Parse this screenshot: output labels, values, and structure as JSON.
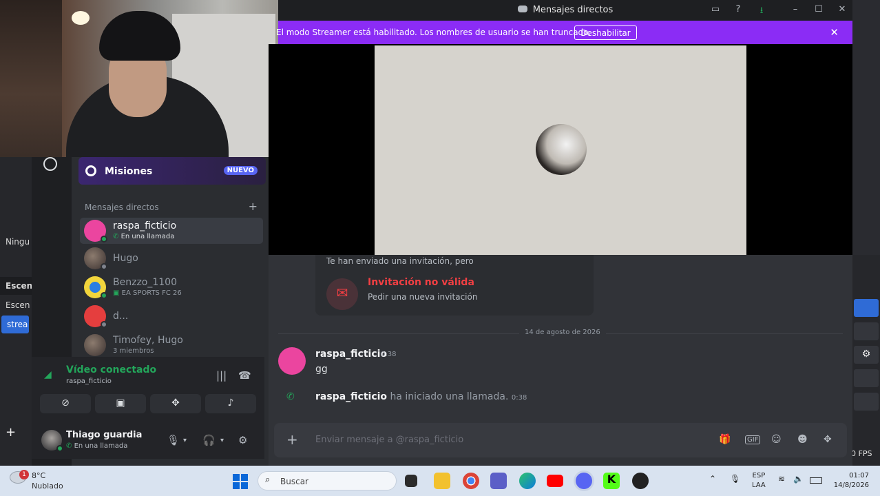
{
  "window": {
    "title": "Mensajes directos"
  },
  "banner": {
    "text": "El modo Streamer está habilitado. Los nombres de usuario se han truncado.",
    "button": "Deshabilitar",
    "color": "#8b2cf5"
  },
  "background_app": {
    "rows": [
      "Ningu",
      "Escen",
      "Escen",
      "strea"
    ],
    "fps": "0 FPS"
  },
  "sidebar": {
    "quests_label": "Misiones",
    "quests_badge": "NUEVO",
    "dm_header": "Mensajes directos",
    "dms": [
      {
        "name": "raspa_ficticio",
        "status": "En una llamada"
      },
      {
        "name": "Hugo",
        "status": ""
      },
      {
        "name": "Benzzo_1100",
        "status": "EA SPORTS FC 26"
      },
      {
        "name": "d...",
        "status": ""
      },
      {
        "name": "Timofey, Hugo",
        "status": "3 miembros"
      }
    ]
  },
  "voice_panel": {
    "title": "Vídeo conectado",
    "channel": "raspa_ficticio"
  },
  "user_panel": {
    "name": "Thiago guardia",
    "status": "En una llamada"
  },
  "chat": {
    "invite_header": "Te han enviado una invitación, pero",
    "invite_title": "Invitación no válida",
    "invite_subtitle": "Pedir una nueva invitación",
    "date_divider": "14 de agosto de 2026",
    "message_author": "raspa_ficticio",
    "message_time": "0:38",
    "message_text": "gg",
    "call_author": "raspa_ficticio",
    "call_text": "ha iniciado una llamada.",
    "call_time": "0:38",
    "composer_placeholder": "Enviar mensaje a @raspa_ficticio"
  },
  "taskbar": {
    "weather_temp": "8°C",
    "weather_cond": "Nublado",
    "notification_count": "1",
    "search_label": "Buscar",
    "lang_line1": "ESP",
    "lang_line2": "LAA",
    "time": "01:07",
    "date": "14/8/2026"
  },
  "colors": {
    "accent": "#5865f2",
    "online": "#23a55a",
    "danger": "#f23f43"
  }
}
